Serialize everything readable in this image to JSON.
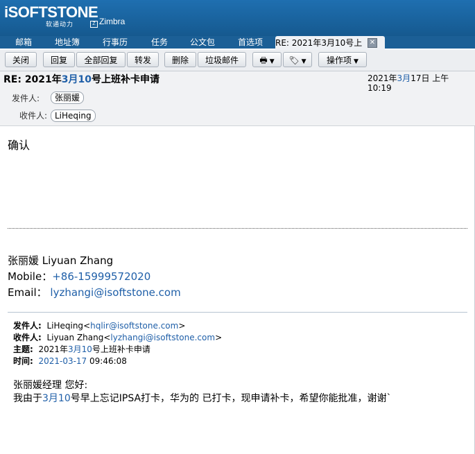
{
  "brand": {
    "logo_text": "iSOFTSTONE",
    "logo_sub": "软通动力",
    "zimbra": "Zimbra"
  },
  "nav": {
    "tabs": [
      "邮箱",
      "地址簿",
      "行事历",
      "任务",
      "公文包",
      "首选项"
    ],
    "current_tab": "RE: 2021年3月10号上"
  },
  "toolbar": {
    "close": "关闭",
    "reply": "回复",
    "reply_all": "全部回复",
    "forward": "转发",
    "delete": "删除",
    "junk": "垃圾邮件",
    "actions": "操作项"
  },
  "message": {
    "subject_pre": "RE: 2021年",
    "subject_mon": "3月",
    "subject_num": "10",
    "subject_post": "号上班补卡申请",
    "date_pre": "2021年",
    "date_mon": "3月",
    "date_post": "17日 上午 10:19",
    "from_label": "发件人:",
    "from": "张丽媛",
    "to_label": "收件人:",
    "to": "LiHeqing"
  },
  "body": {
    "reply": "确认",
    "sig_name": "张丽媛 Liyuan Zhang",
    "sig_mobile_label": "Mobile：",
    "sig_mobile": "+86-15999572020",
    "sig_email_label": "Email：",
    "sig_email": "lyzhangi@isoftstone.com",
    "q_from_label": "发件人:",
    "q_from_name": "LiHeqing",
    "q_from_email": "hqlir@isoftstone.com",
    "q_to_label": "收件人:",
    "q_to_name": "Liyuan Zhang",
    "q_to_email": "lyzhangi@isoftstone.com",
    "q_subject_label": "主题:",
    "q_subject_pre": "2021年",
    "q_subject_mon": "3月",
    "q_subject_num": "10",
    "q_subject_post": "号上班补卡申请",
    "q_time_label": "时间:",
    "q_time_date": "2021-03-17",
    "q_time_clock": "09:46:08",
    "greeting": "张丽媛经理 您好:",
    "line_pre": "我由于",
    "line_mon": "3月",
    "line_num": "10",
    "line_post": "号早上忘记IPSA打卡，华为的 已打卡，现申请补卡，希望你能批准，谢谢`"
  },
  "colors": {
    "accent": "#1f6fb0",
    "link": "#1f5fa8"
  }
}
